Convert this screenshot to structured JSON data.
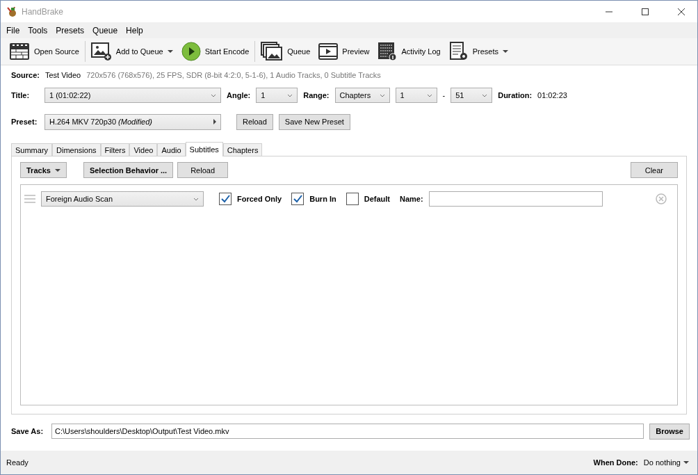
{
  "window": {
    "title": "HandBrake"
  },
  "menu": [
    "File",
    "Tools",
    "Presets",
    "Queue",
    "Help"
  ],
  "toolbar": [
    {
      "label": "Open Source",
      "dropdown": false
    },
    {
      "label": "Add to Queue",
      "dropdown": true
    },
    {
      "label": "Start Encode",
      "dropdown": false
    },
    {
      "label": "Queue",
      "dropdown": false
    },
    {
      "label": "Preview",
      "dropdown": false
    },
    {
      "label": "Activity Log",
      "dropdown": false
    },
    {
      "label": "Presets",
      "dropdown": true
    }
  ],
  "source": {
    "label": "Source:",
    "name": "Test Video",
    "info": "720x576 (768x576), 25 FPS, SDR (8-bit 4:2:0, 5-1-6), 1 Audio Tracks, 0 Subtitle Tracks"
  },
  "title_row": {
    "title_label": "Title:",
    "title": "1  (01:02:22)",
    "angle_label": "Angle:",
    "angle": "1",
    "range_label": "Range:",
    "range": "Chapters",
    "range_start": "1",
    "dash": "-",
    "range_end": "51",
    "duration_label": "Duration:",
    "duration": "01:02:23"
  },
  "preset": {
    "label": "Preset:",
    "value": "H.264 MKV 720p30",
    "modified": "(Modified)",
    "buttons": [
      "Reload",
      "Save New Preset"
    ]
  },
  "tabs": [
    {
      "label": "Summary",
      "selected": false
    },
    {
      "label": "Dimensions",
      "selected": false
    },
    {
      "label": "Filters",
      "selected": false
    },
    {
      "label": "Video",
      "selected": false
    },
    {
      "label": "Audio",
      "selected": false
    },
    {
      "label": "Subtitles",
      "selected": true
    },
    {
      "label": "Chapters",
      "selected": false
    }
  ],
  "subtitle_toolbar": {
    "tracks": "Tracks",
    "selection_behavior": "Selection Behavior ...",
    "reload": "Reload",
    "clear": "Clear"
  },
  "subtitle_tracks": [
    {
      "track": "Foreign Audio Scan",
      "options": [
        {
          "label": "Forced Only",
          "checked": true
        },
        {
          "label": "Burn In",
          "checked": true
        },
        {
          "label": "Default",
          "checked": false
        }
      ],
      "name_label": "Name:"
    }
  ],
  "save_as": {
    "label": "Save As:",
    "value": "C:\\Users\\shoulders\\Desktop\\Output\\Test Video.mkv",
    "browse": "Browse"
  },
  "status_bar": {
    "status": "Ready",
    "when_done_label": "When Done:",
    "when_done": "Do nothing"
  }
}
